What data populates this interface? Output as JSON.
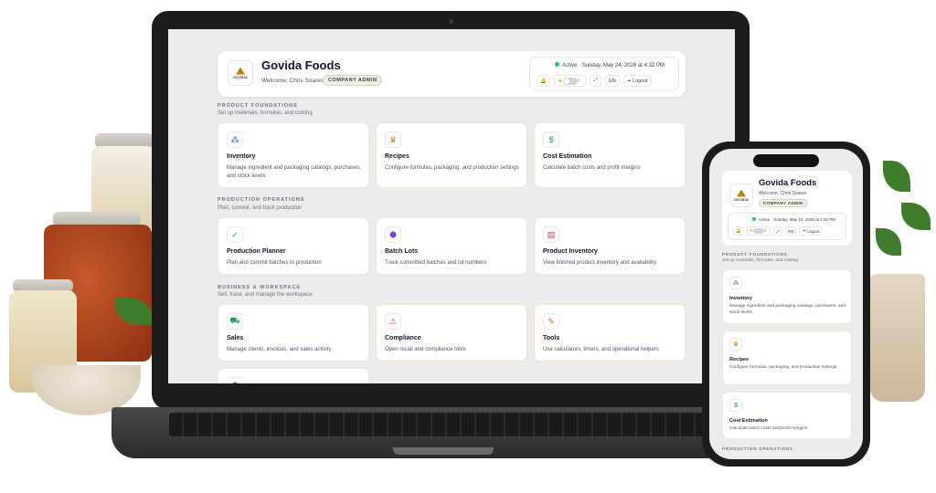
{
  "colors": {
    "accent": "#22c55e",
    "warning": "#dc2626",
    "blue": "#2563eb",
    "amber": "#f59e0b"
  },
  "header": {
    "company": "Govida Foods",
    "logo_text": "GOVIDA",
    "welcome": "Welcome, Chris Soares",
    "role_badge": "COMPANY ADMIN",
    "status": "Active",
    "datetime": "Sunday, May 24, 2026 at 4:32 PM",
    "lang": "EN",
    "logout": "Logout"
  },
  "sections": [
    {
      "title": "PRODUCT FOUNDATIONS",
      "subtitle": "Set up materials, formulas, and costing",
      "cards": [
        {
          "title": "Inventory",
          "desc": "Manage ingredient and packaging catalogs, purchases, and stock levels",
          "icon": "boxes-icon"
        },
        {
          "title": "Recipes",
          "desc": "Configure formulas, packaging, and production settings",
          "icon": "chef-hat-icon"
        },
        {
          "title": "Cost Estimation",
          "desc": "Calculate batch costs and profit margins",
          "icon": "dollar-icon"
        }
      ]
    },
    {
      "title": "PRODUCTION OPERATIONS",
      "subtitle": "Plan, commit, and track production",
      "cards": [
        {
          "title": "Production Planner",
          "desc": "Plan and commit batches to production",
          "icon": "check-circle-icon"
        },
        {
          "title": "Batch Lots",
          "desc": "Track committed batches and lot numbers",
          "icon": "cube-icon"
        },
        {
          "title": "Product Inventory",
          "desc": "View finished product inventory and availability",
          "icon": "archive-icon"
        }
      ]
    },
    {
      "title": "BUSINESS & WORKSPACE",
      "subtitle": "Sell, trace, and manage the workspace",
      "cards": [
        {
          "title": "Sales",
          "desc": "Manage clients, invoices, and sales activity",
          "icon": "cart-icon"
        },
        {
          "title": "Compliance",
          "desc": "Open recall and compliance tools",
          "icon": "alert-triangle-icon"
        },
        {
          "title": "Tools",
          "desc": "Use calculators, timers, and operational helpers",
          "icon": "wrench-icon"
        }
      ]
    }
  ]
}
